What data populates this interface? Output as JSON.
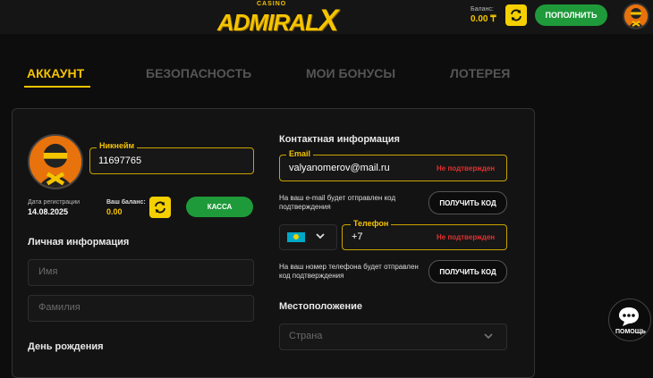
{
  "header": {
    "logo_small": "CASINO",
    "logo_main": "ADMIRAL",
    "logo_x": "X",
    "balance_label": "Баланс:",
    "balance_value": "0.00 ₸",
    "deposit_label": "ПОПОЛНИТЬ"
  },
  "tabs": [
    {
      "label": "АККАУНТ",
      "active": true
    },
    {
      "label": "БЕЗОПАСНОСТЬ",
      "active": false
    },
    {
      "label": "МОИ БОНУСЫ",
      "active": false
    },
    {
      "label": "ЛОТЕРЕЯ",
      "active": false
    }
  ],
  "profile": {
    "nickname_label": "Никнейм",
    "nickname_value": "11697765",
    "reg_date_label": "Дата регистрации",
    "reg_date_value": "14.08.2025",
    "balance_label": "Ваш баланс:",
    "balance_value": "0.00",
    "kassa_label": "КАССА"
  },
  "personal": {
    "title": "Личная информация",
    "first_name_placeholder": "Имя",
    "last_name_placeholder": "Фамилия",
    "birthday_title": "День рождения"
  },
  "contact": {
    "title": "Контактная информация",
    "email_label": "Email",
    "email_value": "valyanomerov@mail.ru",
    "email_status": "Не подтвержден",
    "email_hint": "На ваш e-mail будет отправлен код подтверждения",
    "get_code_label": "ПОЛУЧИТЬ КОД",
    "phone_label": "Телефон",
    "phone_value": "+7",
    "phone_status": "Не подтвержден",
    "phone_hint": "На ваш номер телефона будет отправлен код подтверждения"
  },
  "location": {
    "title": "Местоположение",
    "country_placeholder": "Страна"
  },
  "help": {
    "label": "ПОМОЩЬ"
  },
  "colors": {
    "accent": "#f5c400",
    "green": "#1f9a3a",
    "danger": "#e23030",
    "background": "#0d0d0d"
  }
}
